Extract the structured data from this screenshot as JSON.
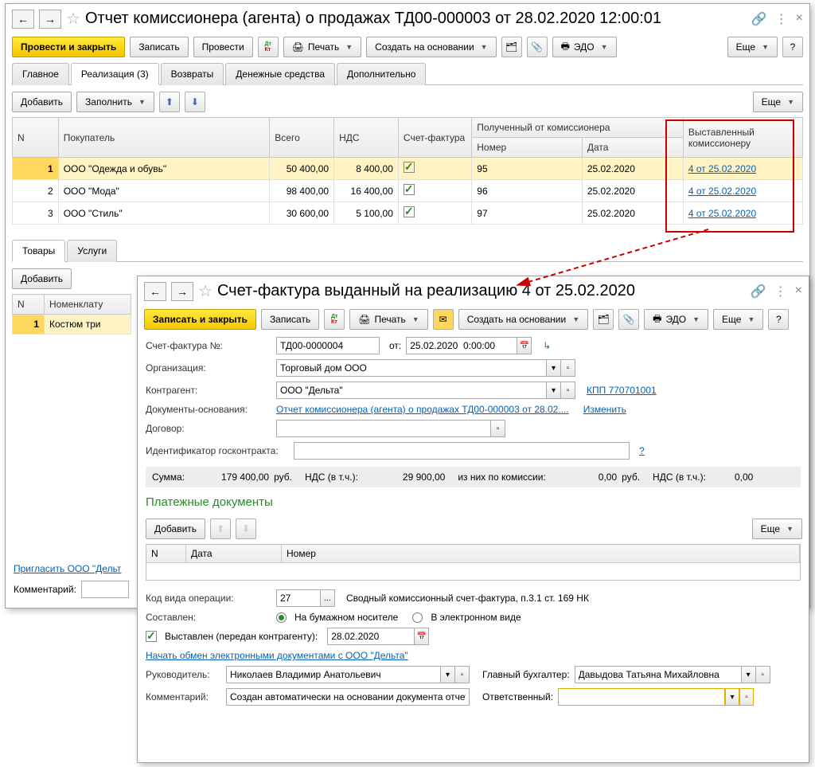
{
  "win1": {
    "title": "Отчет комиссионера (агента) о продажах ТД00-000003 от 28.02.2020 12:00:01",
    "toolbar": {
      "primary": "Провести и закрыть",
      "save": "Записать",
      "post": "Провести",
      "print": "Печать",
      "createBased": "Создать на основании",
      "edo": "ЭДО",
      "more": "Еще"
    },
    "tabs": [
      "Главное",
      "Реализация (3)",
      "Возвраты",
      "Денежные средства",
      "Дополнительно"
    ],
    "activeTab": 1,
    "subtoolbar": {
      "add": "Добавить",
      "fill": "Заполнить",
      "more": "Еще"
    },
    "grid": {
      "headers": {
        "n": "N",
        "buyer": "Покупатель",
        "total": "Всего",
        "vat": "НДС",
        "invoice": "Счет-фактура",
        "received": "Полученный от комиссионера",
        "number": "Номер",
        "date": "Дата",
        "issued": "Выставленный комиссионеру"
      },
      "rows": [
        {
          "n": "1",
          "buyer": "ООО \"Одежда и обувь\"",
          "total": "50 400,00",
          "vat": "8 400,00",
          "sf": true,
          "num": "95",
          "date": "25.02.2020",
          "issued": "4 от 25.02.2020"
        },
        {
          "n": "2",
          "buyer": "ООО \"Мода\"",
          "total": "98 400,00",
          "vat": "16 400,00",
          "sf": true,
          "num": "96",
          "date": "25.02.2020",
          "issued": "4 от 25.02.2020"
        },
        {
          "n": "3",
          "buyer": "ООО \"Стиль\"",
          "total": "30 600,00",
          "vat": "5 100,00",
          "sf": true,
          "num": "97",
          "date": "25.02.2020",
          "issued": "4 от 25.02.2020"
        }
      ]
    },
    "subtabs": [
      "Товары",
      "Услуги"
    ],
    "subtoolbar2": {
      "add": "Добавить"
    },
    "nomHeaders": {
      "n": "N",
      "nom": "Номенклату"
    },
    "nomRows": [
      {
        "n": "1",
        "nom": "Костюм три"
      }
    ],
    "inviteLink": "Пригласить ООО \"Дельт",
    "commentLabel": "Комментарий:"
  },
  "win2": {
    "title": "Счет-фактура выданный на реализацию 4 от 25.02.2020",
    "toolbar": {
      "primary": "Записать и закрыть",
      "save": "Записать",
      "print": "Печать",
      "createBased": "Создать на основании",
      "edo": "ЭДО",
      "more": "Еще"
    },
    "form": {
      "sfno_lbl": "Счет-фактура №:",
      "sfno": "ТД00-0000004",
      "from_lbl": "от:",
      "from": "25.02.2020  0:00:00",
      "org_lbl": "Организация:",
      "org": "Торговый дом ООО",
      "ctr_lbl": "Контрагент:",
      "ctr": "ООО \"Дельта\"",
      "kpp": "КПП 770701001",
      "basis_lbl": "Документы-основания:",
      "basis_link": "Отчет комиссионера (агента) о продажах ТД00-000003 от 28.02....",
      "basis_change": "Изменить",
      "contract_lbl": "Договор:",
      "govid_lbl": "Идентификатор госконтракта:"
    },
    "sum": {
      "sum_lbl": "Сумма:",
      "sum": "179 400,00",
      "rub1": "руб.",
      "vat_lbl": "НДС (в т.ч.):",
      "vat": "29 900,00",
      "comm_lbl": "из них по комиссии:",
      "comm": "0,00",
      "rub2": "руб.",
      "vat2_lbl": "НДС (в т.ч.):",
      "vat2": "0,00"
    },
    "paySection": "Платежные документы",
    "payToolbar": {
      "add": "Добавить",
      "more": "Еще"
    },
    "payHeaders": {
      "n": "N",
      "date": "Дата",
      "num": "Номер"
    },
    "opcode_lbl": "Код вида операции:",
    "opcode": "27",
    "opcode_desc": "Сводный комиссионный счет-фактура, п.3.1 ст. 169 НК",
    "compiled_lbl": "Составлен:",
    "compiled_opt1": "На бумажном носителе",
    "compiled_opt2": "В электронном виде",
    "issued_lbl": "Выставлен (передан контрагенту):",
    "issued_date": "28.02.2020",
    "edo_link": "Начать обмен электронными документами с ООО \"Дельта\"",
    "head_lbl": "Руководитель:",
    "head": "Николаев Владимир Анатольевич",
    "acc_lbl": "Главный бухгалтер:",
    "acc": "Давыдова Татьяна Михайловна",
    "comment_lbl": "Комментарий:",
    "comment": "Создан автоматически на основании документа отчет",
    "resp_lbl": "Ответственный:"
  }
}
